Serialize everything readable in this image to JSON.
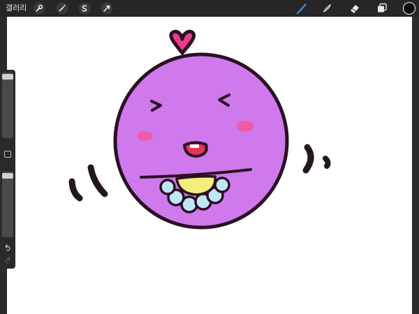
{
  "topbar": {
    "gallery_label": "갤러리",
    "left_tools": [
      {
        "name": "wrench-icon",
        "label": "actions"
      },
      {
        "name": "magic-wand-icon",
        "label": "adjustments"
      },
      {
        "name": "selection-s-icon",
        "label": "selection"
      },
      {
        "name": "arrow-cursor-icon",
        "label": "transform"
      }
    ],
    "right_tools": [
      {
        "name": "brush-icon",
        "active": true
      },
      {
        "name": "smudge-icon",
        "active": false
      },
      {
        "name": "eraser-icon",
        "active": false
      },
      {
        "name": "layers-icon",
        "active": false
      },
      {
        "name": "color-swatch-icon",
        "active": false
      }
    ],
    "active_tool_color": "#3f8ee8",
    "current_color": "#0b0b0b"
  },
  "sidebar": {
    "brush_size_level": 0.04,
    "opacity_level": 0.04,
    "icons": [
      "modify-square-icon",
      "undo-icon",
      "redo-icon"
    ]
  },
  "artwork": {
    "face_color": "#cf79ec",
    "outline_color": "#2a1022",
    "heart_color": "#ea3c8c",
    "blush_color": "#f05ba8",
    "mouth_color": "#e8345a",
    "bib_center_color": "#f4ef7a",
    "bib_petal_color": "#bfe6f6"
  }
}
